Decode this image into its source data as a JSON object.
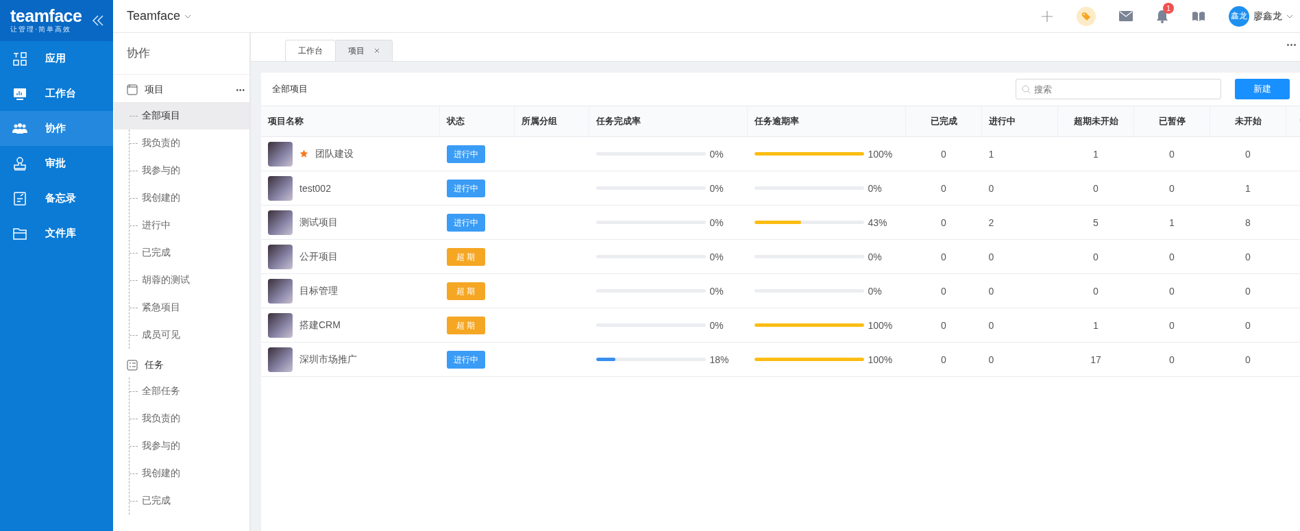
{
  "logo": {
    "name": "teamface",
    "slogan": "让管理·简单高效"
  },
  "nav": [
    {
      "label": "应用",
      "selected": false
    },
    {
      "label": "工作台",
      "selected": false
    },
    {
      "label": "协作",
      "selected": true
    },
    {
      "label": "审批",
      "selected": false
    },
    {
      "label": "备忘录",
      "selected": false
    },
    {
      "label": "文件库",
      "selected": false
    }
  ],
  "header": {
    "company": "Teamface",
    "notification_count": "1",
    "avatar_text": "鑫龙",
    "user_name": "廖鑫龙"
  },
  "sidebar": {
    "title": "协作",
    "groups": [
      {
        "label": "项目",
        "more": "•••",
        "items": [
          {
            "label": "全部项目",
            "selected": true
          },
          {
            "label": "我负责的",
            "selected": false
          },
          {
            "label": "我参与的",
            "selected": false
          },
          {
            "label": "我创建的",
            "selected": false
          },
          {
            "label": "进行中",
            "selected": false
          },
          {
            "label": "已完成",
            "selected": false
          },
          {
            "label": "胡蓉的测试",
            "selected": false
          },
          {
            "label": "紧急项目",
            "selected": false
          },
          {
            "label": "成员可见",
            "selected": false
          }
        ]
      },
      {
        "label": "任务",
        "items": [
          {
            "label": "全部任务",
            "selected": false
          },
          {
            "label": "我负责的",
            "selected": false
          },
          {
            "label": "我参与的",
            "selected": false
          },
          {
            "label": "我创建的",
            "selected": false
          },
          {
            "label": "已完成",
            "selected": false
          }
        ]
      }
    ]
  },
  "tabs": [
    {
      "label": "工作台",
      "selected": false,
      "closable": false
    },
    {
      "label": "项目",
      "selected": true,
      "closable": true
    }
  ],
  "panel": {
    "title": "全部项目",
    "search": {
      "placeholder": "搜索"
    },
    "new_button": "新建"
  },
  "table": {
    "columns": [
      "项目名称",
      "状态",
      "所属分组",
      "任务完成率",
      "任务逾期率",
      "已完成",
      "进行中",
      "超期未开始",
      "已暂停",
      "未开始"
    ],
    "rows": [
      {
        "name": "团队建设",
        "starred": true,
        "status": {
          "kind": "active",
          "label": "进行中"
        },
        "completion": {
          "level": 0,
          "reading": "0%"
        },
        "overdue": {
          "level": 1,
          "reading": "100%"
        },
        "done": "0",
        "in_progress": "1",
        "late_unstarted": "1",
        "paused": "0",
        "unstarted": "0"
      },
      {
        "name": "test002",
        "starred": false,
        "status": {
          "kind": "active",
          "label": "进行中"
        },
        "completion": {
          "level": 0,
          "reading": "0%"
        },
        "overdue": {
          "level": 0,
          "reading": "0%"
        },
        "done": "0",
        "in_progress": "0",
        "late_unstarted": "0",
        "paused": "0",
        "unstarted": "1"
      },
      {
        "name": "测试项目",
        "starred": false,
        "status": {
          "kind": "active",
          "label": "进行中"
        },
        "completion": {
          "level": 0,
          "reading": "0%"
        },
        "overdue": {
          "level": 0.43,
          "reading": "43%"
        },
        "done": "0",
        "in_progress": "2",
        "late_unstarted": "5",
        "paused": "1",
        "unstarted": "8"
      },
      {
        "name": "公开项目",
        "starred": false,
        "status": {
          "kind": "overdue",
          "label": "超 期"
        },
        "completion": {
          "level": 0,
          "reading": "0%"
        },
        "overdue": {
          "level": 0,
          "reading": "0%"
        },
        "done": "0",
        "in_progress": "0",
        "late_unstarted": "0",
        "paused": "0",
        "unstarted": "0"
      },
      {
        "name": "目标管理",
        "starred": false,
        "status": {
          "kind": "overdue",
          "label": "超 期"
        },
        "completion": {
          "level": 0,
          "reading": "0%"
        },
        "overdue": {
          "level": 0,
          "reading": "0%"
        },
        "done": "0",
        "in_progress": "0",
        "late_unstarted": "0",
        "paused": "0",
        "unstarted": "0"
      },
      {
        "name": "搭建CRM",
        "starred": false,
        "status": {
          "kind": "overdue",
          "label": "超 期"
        },
        "completion": {
          "level": 0,
          "reading": "0%"
        },
        "overdue": {
          "level": 1,
          "reading": "100%"
        },
        "done": "0",
        "in_progress": "0",
        "late_unstarted": "1",
        "paused": "0",
        "unstarted": "0"
      },
      {
        "name": "深圳市场推广",
        "starred": false,
        "status": {
          "kind": "active",
          "label": "进行中"
        },
        "completion": {
          "level": 0.18,
          "reading": "18%"
        },
        "overdue": {
          "level": 1,
          "reading": "100%"
        },
        "done": "0",
        "in_progress": "0",
        "late_unstarted": "17",
        "paused": "0",
        "unstarted": "0"
      }
    ]
  }
}
